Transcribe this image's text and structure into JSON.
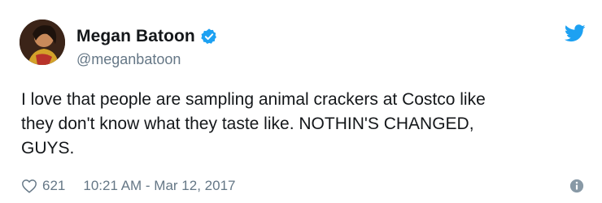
{
  "tweet": {
    "author": {
      "display_name": "Megan Batoon",
      "handle": "@meganbatoon",
      "verified": true
    },
    "text": "I love that people are sampling animal crackers at Costco like\nthey don't know what they taste like. NOTHIN'S CHANGED,\nGUYS.",
    "likes": "621",
    "timestamp": "10:21 AM - Mar 12, 2017"
  },
  "icons": {
    "verified": "verified-badge-icon",
    "bird": "twitter-bird-icon",
    "like": "heart-icon",
    "info": "info-icon"
  },
  "colors": {
    "brand": "#1da1f2",
    "text": "#14171a",
    "secondary": "#657786"
  }
}
